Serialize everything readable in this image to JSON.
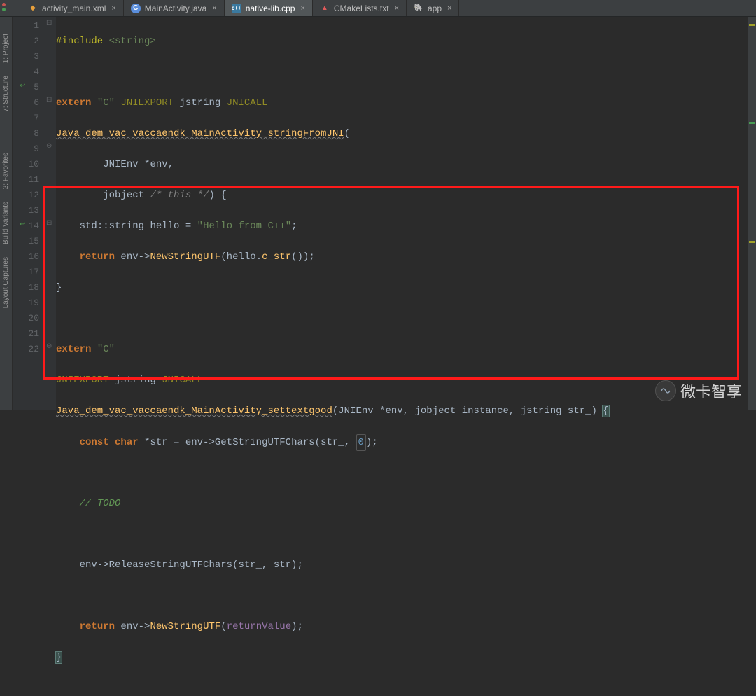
{
  "tabs": [
    {
      "label": "activity_main.xml",
      "icon": "xml",
      "iconChar": "◆",
      "active": false
    },
    {
      "label": "MainActivity.java",
      "icon": "java",
      "iconChar": "C",
      "active": false
    },
    {
      "label": "native-lib.cpp",
      "icon": "cpp",
      "iconChar": "c++",
      "active": true
    },
    {
      "label": "CMakeLists.txt",
      "icon": "cmake",
      "iconChar": "▲",
      "active": false
    },
    {
      "label": "app",
      "icon": "app",
      "iconChar": "🐘",
      "active": false
    }
  ],
  "sidebar": {
    "labels": [
      "1: Project",
      "7: Structure",
      "2: Favorites",
      "Build Variants",
      "Layout Captures"
    ]
  },
  "gutter": {
    "start": 1,
    "end": 22
  },
  "code": {
    "l1": {
      "p1": "#include ",
      "p2": "<string>"
    },
    "l3": {
      "p1": "extern",
      "p2": "\"C\"",
      "p3": "JNIEXPORT",
      "p4": "jstring",
      "p5": "JNICALL"
    },
    "l4": {
      "fn": "Java_dem_vac_vaccaendk_MainActivity_stringFromJNI",
      "open": "("
    },
    "l5": {
      "p1": "JNIEnv *",
      "p2": "env",
      "p3": ","
    },
    "l6": {
      "p1": "jobject",
      "p2": "/* this */",
      "p3": ") {"
    },
    "l7": {
      "p1": "std::",
      "p2": "string",
      "p3": " hello = ",
      "p4": "\"Hello from C++\"",
      "p5": ";"
    },
    "l8": {
      "p1": "return",
      "p2": " env->",
      "p3": "NewStringUTF",
      "p4": "(hello.",
      "p5": "c_str",
      "p6": "());"
    },
    "l9": {
      "p1": "}"
    },
    "l11": {
      "p1": "extern",
      "p2": "\"C\""
    },
    "l12": {
      "p1": "JNIEXPORT",
      "p2": "jstring",
      "p3": "JNICALL"
    },
    "l13": {
      "fn": "Java_dem_vac_vaccaendk_MainActivity_settextgood",
      "args": "(JNIEnv *env, jobject instance, jstring str_)",
      "open": "{"
    },
    "l14": {
      "p1": "const",
      "p2": "char",
      "p3": " *str = env->GetStringUTFChars(str_, ",
      "p4": "0",
      "p5": ");"
    },
    "l16": {
      "p1": "// TODO"
    },
    "l18": {
      "p1": "env->ReleaseStringUTFChars(str_, str);"
    },
    "l20": {
      "p1": "return",
      "p2": " env->",
      "p3": "NewStringUTF",
      "p4": "(",
      "p5": "returnValue",
      "p6": ");"
    },
    "l21": {
      "p1": "}"
    }
  },
  "watermark": {
    "text": "微卡智享"
  }
}
